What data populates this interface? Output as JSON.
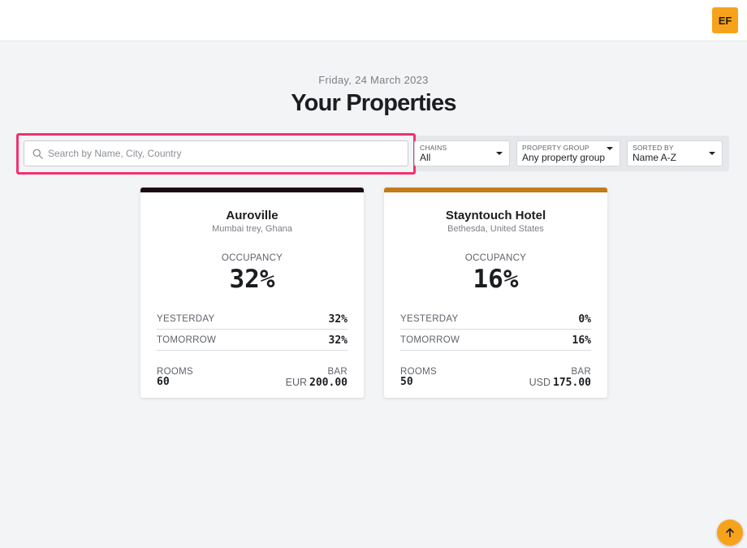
{
  "header": {
    "user_initials": "EF",
    "accent_color": "#f7a21b"
  },
  "page": {
    "date": "Friday, 24 March 2023",
    "title": "Your Properties"
  },
  "filters": {
    "search_placeholder": "Search by Name, City, Country",
    "search_value": "",
    "chains": {
      "label": "CHAINS",
      "value": "All"
    },
    "property_group": {
      "label": "PROPERTY GROUP",
      "value": "Any property group"
    },
    "sorted_by": {
      "label": "SORTED BY",
      "value": "Name A-Z"
    },
    "highlight_color": "#f2326e"
  },
  "properties": [
    {
      "name": "Auroville",
      "location": "Mumbai trey, Ghana",
      "stripe_color": "#1a0a12",
      "occupancy_label": "OCCUPANCY",
      "occupancy": "32%",
      "yesterday_label": "YESTERDAY",
      "yesterday": "32%",
      "tomorrow_label": "TOMORROW",
      "tomorrow": "32%",
      "rooms_label": "ROOMS",
      "rooms": "60",
      "bar_label": "BAR",
      "bar_currency": "EUR",
      "bar_value": "200.00"
    },
    {
      "name": "Stayntouch Hotel",
      "location": "Bethesda, United States",
      "stripe_color": "#c27c1a",
      "occupancy_label": "OCCUPANCY",
      "occupancy": "16%",
      "yesterday_label": "YESTERDAY",
      "yesterday": "0%",
      "tomorrow_label": "TOMORROW",
      "tomorrow": "16%",
      "rooms_label": "ROOMS",
      "rooms": "50",
      "bar_label": "BAR",
      "bar_currency": "USD",
      "bar_value": "175.00"
    }
  ],
  "scroll_top": {
    "icon": "arrow-up-icon"
  }
}
